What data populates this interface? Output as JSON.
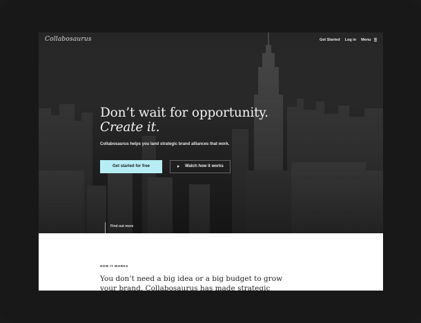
{
  "nav": {
    "logo": "Collabosaurus",
    "get_started": "Get Started",
    "log_in": "Log in",
    "menu": "Menu"
  },
  "hero": {
    "headline_line1": "Don’t wait for opportunity.",
    "headline_line2": "Create it.",
    "subline": "Collabosaurus helps you land strategic brand alliances that work.",
    "primary_button": "Get started for free",
    "video_button": "Watch how it works",
    "find_out_more": "Find out more"
  },
  "how_it_works": {
    "eyebrow": "HOW IT WORKS",
    "body": "You don’t need a big idea or a big budget to grow your brand. Collabosaurus has made strategic partnerships easy."
  },
  "colors": {
    "accent": "#b7eef6",
    "hero_bg": "#262626",
    "frame": "#181818"
  },
  "icons": [
    "menu-icon",
    "play-icon"
  ]
}
